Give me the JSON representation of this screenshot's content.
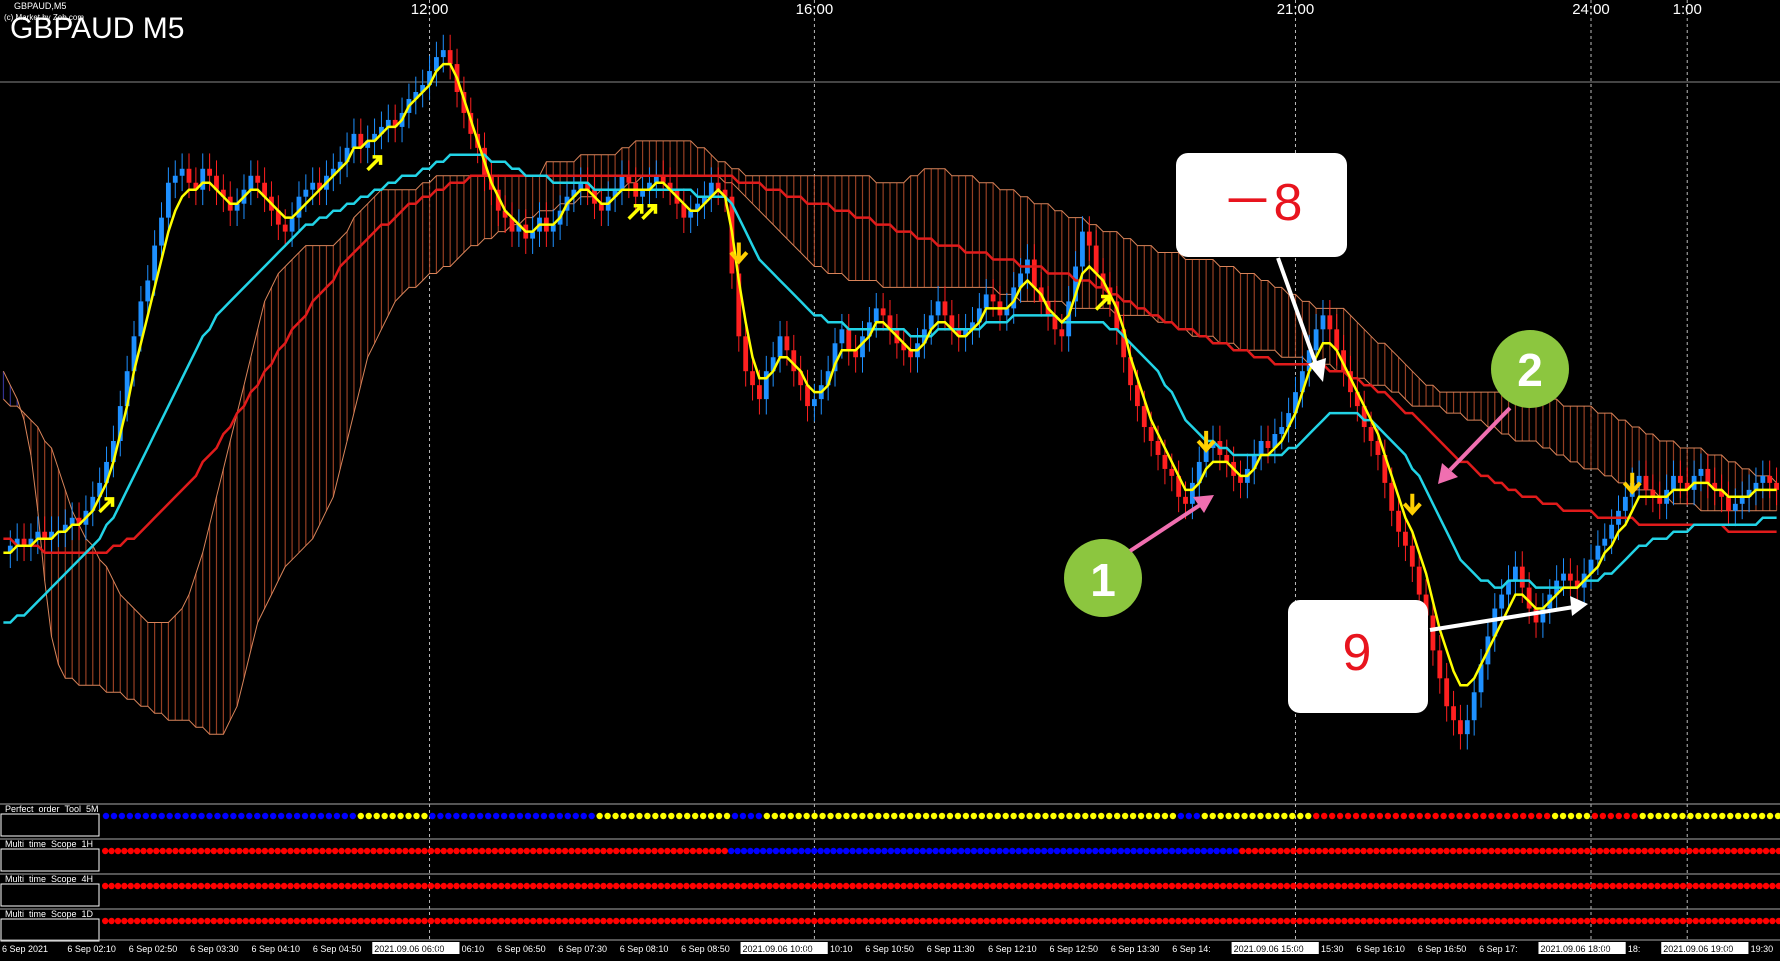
{
  "window": {
    "title": "GBPAUD,M5",
    "subtitle": "(c) Market by Zeb.com",
    "symbol_label": "GBPAUD M5"
  },
  "colors": {
    "background": "#000000",
    "bull_candle": "#1e90ff",
    "bear_candle": "#ff2020",
    "ma_fast": "#ffff00",
    "ma_mid": "#22d3e6",
    "ma_slow": "#e01b1b",
    "cloud_bear_fill": "#b04a2a",
    "cloud_bull_fill": "#3a3aa8",
    "cloud_edge": "#d8845a",
    "arrow_up": "#ffff00",
    "arrow_down": "#ffd000",
    "callout_green": "#8cc63f",
    "callout_pink": "#f06fb0",
    "callout_white": "#ffffff",
    "callout_text_red": "#e8141e",
    "dot_blue": "#0000ff",
    "dot_yellow": "#ffff00",
    "dot_red": "#ff0000"
  },
  "annotations": {
    "box_minus8": "－8",
    "box_9": "9",
    "circle_1": "1",
    "circle_2": "2"
  },
  "chart_data": {
    "type": "line",
    "price_axis": "none",
    "time_labels_top": [
      {
        "label": "12:00",
        "index": 62
      },
      {
        "label": "16:00",
        "index": 118
      },
      {
        "label": "21:00",
        "index": 188
      },
      {
        "label": "24:00",
        "index": 231
      },
      {
        "label": "1:00",
        "index": 245
      }
    ],
    "time_labels_bottom": [
      "6 Sep 2021",
      "6 Sep 02:10",
      "6 Sep 02:50",
      "6 Sep 03:30",
      "6 Sep 04:10",
      "6 Sep 04:50",
      "2021.09.06 06:00",
      "6 Sep 06:10",
      "6 Sep 06:50",
      "6 Sep 07:30",
      "6 Sep 08:10",
      "6 Sep 08:50",
      "2021.09.06 10:00",
      "6 Sep 10:10",
      "6 Sep 10:50",
      "6 Sep 11:30",
      "6 Sep 12:10",
      "6 Sep 12:50",
      "6 Sep 13:30",
      "6 Sep 14:",
      "2021.09.06 15:00",
      "6 Sep 15:30",
      "6 Sep 16:10",
      "6 Sep 16:50",
      "6 Sep 17:",
      "2021.09.06 18:00",
      "6 Sep 18:",
      "2021.09.06 19:00",
      "6 Sep 19:30"
    ],
    "bars": 259,
    "price_scale": {
      "min": 0,
      "max": 100
    },
    "close": [
      34,
      35,
      36,
      35,
      36,
      37,
      36,
      37,
      37,
      38,
      39,
      38,
      40,
      42,
      44,
      47,
      50,
      55,
      60,
      65,
      70,
      73,
      78,
      82,
      87,
      88,
      89,
      87,
      86,
      89,
      88,
      86,
      85,
      83,
      84,
      86,
      88,
      87,
      85,
      83,
      81,
      80,
      82,
      85,
      86,
      87,
      86,
      88,
      89,
      90,
      92,
      94,
      92,
      93,
      94,
      95,
      96,
      95,
      97,
      99,
      100,
      101,
      103,
      105,
      106,
      104,
      100,
      97,
      94,
      92,
      88,
      86,
      83,
      82,
      80,
      81,
      79,
      80,
      82,
      80,
      81,
      83,
      85,
      86,
      87,
      86,
      84,
      83,
      85,
      86,
      88,
      87,
      85,
      86,
      87,
      88,
      87,
      86,
      84,
      82,
      83,
      84,
      85,
      87,
      86,
      85,
      74,
      65,
      60,
      58,
      56,
      60,
      62,
      65,
      63,
      60,
      58,
      55,
      56,
      58,
      60,
      64,
      66,
      63,
      62,
      65,
      67,
      69,
      68,
      66,
      64,
      63,
      62,
      64,
      66,
      68,
      70,
      68,
      66,
      65,
      66,
      67,
      69,
      71,
      70,
      68,
      69,
      72,
      74,
      76,
      72,
      70,
      68,
      66,
      65,
      70,
      75,
      80,
      78,
      74,
      72,
      70,
      66,
      62,
      58,
      55,
      52,
      50,
      48,
      46,
      45,
      42,
      41,
      44,
      47,
      49,
      50,
      48,
      47,
      45,
      44,
      46,
      48,
      50,
      49,
      51,
      52,
      54,
      57,
      60,
      63,
      66,
      68,
      66,
      63,
      60,
      57,
      55,
      52,
      50,
      48,
      44,
      40,
      37,
      35,
      32,
      28,
      25,
      20,
      16,
      12,
      10,
      8,
      10,
      14,
      18,
      22,
      26,
      28,
      30,
      32,
      29,
      26,
      24,
      26,
      28,
      30,
      31,
      30,
      29,
      31,
      33,
      35,
      36,
      38,
      40,
      42,
      44,
      45,
      43,
      42,
      41,
      43,
      45,
      44,
      43,
      45,
      46,
      44,
      43,
      42,
      40,
      41,
      42,
      43,
      44,
      45,
      44,
      43
    ],
    "ma_fast": [
      34,
      34,
      35,
      35,
      35,
      36,
      36,
      36,
      37,
      37,
      38,
      38,
      39,
      40,
      42,
      44,
      47,
      51,
      55,
      60,
      64,
      68,
      72,
      76,
      80,
      83,
      85,
      86,
      86,
      87,
      87,
      86,
      85,
      84,
      84,
      85,
      86,
      86,
      85,
      84,
      83,
      82,
      82,
      83,
      84,
      85,
      86,
      87,
      88,
      89,
      90,
      92,
      92,
      93,
      93,
      94,
      95,
      95,
      96,
      98,
      99,
      100,
      101,
      103,
      104,
      104,
      102,
      99,
      96,
      93,
      90,
      87,
      85,
      83,
      82,
      81,
      80,
      80,
      81,
      81,
      81,
      82,
      84,
      85,
      86,
      86,
      85,
      84,
      84,
      85,
      86,
      86,
      86,
      86,
      86,
      87,
      87,
      86,
      85,
      84,
      83,
      83,
      84,
      85,
      86,
      85,
      80,
      73,
      67,
      62,
      59,
      59,
      60,
      62,
      62,
      61,
      60,
      58,
      57,
      57,
      58,
      61,
      63,
      63,
      63,
      64,
      65,
      67,
      67,
      66,
      65,
      64,
      63,
      63,
      64,
      66,
      67,
      67,
      66,
      65,
      65,
      66,
      67,
      69,
      69,
      69,
      69,
      70,
      72,
      73,
      72,
      71,
      69,
      68,
      67,
      68,
      71,
      74,
      75,
      74,
      73,
      71,
      69,
      66,
      62,
      59,
      56,
      53,
      51,
      49,
      47,
      45,
      43,
      43,
      44,
      46,
      47,
      47,
      47,
      46,
      45,
      45,
      46,
      48,
      48,
      49,
      50,
      52,
      54,
      57,
      60,
      62,
      64,
      64,
      63,
      61,
      59,
      57,
      55,
      53,
      51,
      48,
      45,
      42,
      39,
      37,
      34,
      31,
      27,
      23,
      20,
      17,
      15,
      15,
      16,
      18,
      20,
      22,
      24,
      26,
      28,
      28,
      27,
      26,
      26,
      27,
      28,
      29,
      29,
      29,
      30,
      31,
      32,
      34,
      35,
      37,
      38,
      40,
      42,
      42,
      42,
      42,
      42,
      43,
      43,
      43,
      44,
      44,
      44,
      43,
      43,
      42,
      42,
      42,
      42,
      43,
      43,
      43,
      43
    ],
    "ma_mid": [
      24,
      24,
      25,
      25,
      26,
      27,
      28,
      29,
      30,
      31,
      32,
      33,
      34,
      35,
      36,
      38,
      39,
      41,
      43,
      45,
      47,
      49,
      51,
      53,
      55,
      57,
      59,
      61,
      63,
      65,
      66,
      68,
      69,
      70,
      71,
      72,
      73,
      74,
      75,
      76,
      77,
      78,
      79,
      80,
      81,
      81,
      82,
      82,
      83,
      83,
      84,
      84,
      85,
      85,
      86,
      86,
      87,
      87,
      88,
      88,
      88,
      89,
      89,
      90,
      90,
      91,
      91,
      91,
      91,
      91,
      91,
      90,
      90,
      90,
      89,
      89,
      88,
      88,
      88,
      88,
      87,
      87,
      87,
      87,
      87,
      87,
      86,
      86,
      86,
      86,
      86,
      86,
      86,
      86,
      86,
      86,
      86,
      86,
      86,
      86,
      86,
      85,
      85,
      85,
      85,
      85,
      84,
      82,
      80,
      78,
      76,
      75,
      74,
      73,
      72,
      71,
      70,
      69,
      68,
      68,
      67,
      67,
      67,
      66,
      66,
      66,
      66,
      66,
      66,
      66,
      66,
      66,
      65,
      65,
      65,
      65,
      66,
      66,
      66,
      66,
      66,
      66,
      66,
      67,
      67,
      67,
      67,
      68,
      68,
      68,
      68,
      68,
      68,
      68,
      67,
      67,
      67,
      67,
      67,
      67,
      67,
      66,
      66,
      65,
      64,
      63,
      62,
      61,
      60,
      58,
      57,
      55,
      53,
      52,
      51,
      50,
      50,
      49,
      49,
      48,
      48,
      48,
      48,
      48,
      48,
      48,
      48,
      49,
      49,
      50,
      51,
      52,
      53,
      54,
      54,
      54,
      54,
      54,
      53,
      53,
      52,
      51,
      50,
      49,
      48,
      46,
      45,
      43,
      41,
      39,
      37,
      35,
      33,
      32,
      31,
      30,
      30,
      29,
      29,
      30,
      30,
      30,
      30,
      29,
      29,
      29,
      29,
      29,
      29,
      29,
      30,
      30,
      30,
      31,
      31,
      32,
      33,
      34,
      35,
      35,
      36,
      36,
      36,
      37,
      37,
      37,
      38,
      38,
      38,
      38,
      38,
      38,
      38,
      38,
      38,
      38,
      39,
      39,
      39
    ],
    "ma_slow": [
      36,
      36,
      35,
      35,
      35,
      35,
      34,
      34,
      34,
      34,
      34,
      34,
      34,
      34,
      34,
      34,
      35,
      35,
      36,
      36,
      37,
      38,
      39,
      40,
      41,
      42,
      43,
      44,
      45,
      47,
      48,
      49,
      51,
      52,
      54,
      55,
      57,
      58,
      60,
      61,
      63,
      64,
      66,
      67,
      68,
      70,
      71,
      72,
      73,
      75,
      76,
      77,
      78,
      79,
      80,
      81,
      81,
      82,
      83,
      84,
      84,
      85,
      85,
      86,
      86,
      87,
      87,
      87,
      88,
      88,
      88,
      88,
      88,
      88,
      88,
      88,
      88,
      88,
      88,
      88,
      88,
      88,
      88,
      88,
      88,
      88,
      88,
      88,
      88,
      88,
      88,
      88,
      88,
      88,
      88,
      88,
      88,
      88,
      88,
      88,
      88,
      88,
      88,
      88,
      88,
      88,
      88,
      87,
      87,
      87,
      87,
      86,
      86,
      86,
      85,
      85,
      85,
      84,
      84,
      84,
      84,
      83,
      83,
      83,
      82,
      82,
      82,
      81,
      81,
      81,
      80,
      80,
      80,
      79,
      79,
      79,
      78,
      78,
      78,
      78,
      77,
      77,
      77,
      77,
      76,
      76,
      76,
      76,
      75,
      75,
      75,
      75,
      74,
      74,
      74,
      74,
      73,
      73,
      73,
      72,
      72,
      71,
      71,
      70,
      70,
      69,
      69,
      68,
      68,
      67,
      67,
      66,
      66,
      66,
      65,
      65,
      64,
      64,
      64,
      63,
      63,
      63,
      62,
      62,
      62,
      61,
      61,
      61,
      61,
      61,
      61,
      61,
      61,
      60,
      60,
      60,
      59,
      59,
      58,
      58,
      57,
      57,
      56,
      55,
      54,
      54,
      53,
      52,
      51,
      50,
      49,
      48,
      47,
      47,
      46,
      45,
      45,
      44,
      44,
      43,
      43,
      42,
      42,
      42,
      41,
      41,
      41,
      40,
      40,
      40,
      40,
      40,
      39,
      39,
      39,
      39,
      39,
      39,
      38,
      38,
      38,
      38,
      38,
      38,
      38,
      38,
      38,
      38,
      38,
      38,
      38,
      37,
      37,
      37,
      37,
      37,
      37,
      37,
      37
    ],
    "cloud_top": [
      56,
      55,
      55,
      54,
      53,
      52,
      50,
      49,
      46,
      43,
      40,
      38,
      36,
      35,
      33,
      32,
      30,
      28,
      27,
      26,
      25,
      24,
      24,
      24,
      24,
      25,
      26,
      28,
      31,
      34,
      38,
      42,
      46,
      50,
      54,
      58,
      62,
      66,
      70,
      72,
      74,
      75,
      76,
      77,
      78,
      78,
      78,
      78,
      78,
      79,
      80,
      82,
      83,
      84,
      85,
      86,
      86,
      86,
      86,
      86,
      86,
      87,
      87,
      88,
      88,
      88,
      88,
      88,
      88,
      88,
      88,
      88,
      88,
      88,
      88,
      88,
      88,
      88,
      88,
      90,
      90,
      90,
      90,
      90,
      91,
      91,
      91,
      91,
      91,
      91,
      92,
      92,
      93,
      93,
      93,
      93,
      93,
      93,
      93,
      93,
      93,
      92,
      92,
      91,
      90,
      90,
      89,
      89,
      88,
      88,
      88,
      88,
      88,
      88,
      88,
      88,
      88,
      88,
      88,
      88,
      88,
      88,
      88,
      88,
      88,
      88,
      88,
      87,
      87,
      87,
      87,
      87,
      88,
      88,
      89,
      89,
      89,
      89,
      88,
      88,
      88,
      88,
      87,
      87,
      87,
      86,
      86,
      86,
      85,
      85,
      84,
      84,
      84,
      83,
      83,
      82,
      82,
      82,
      81,
      81,
      80,
      80,
      80,
      79,
      79,
      78,
      78,
      78,
      77,
      77,
      77,
      77,
      76,
      76,
      76,
      76,
      76,
      75,
      75,
      75,
      74,
      74,
      74,
      73,
      73,
      72,
      72,
      71,
      71,
      70,
      70,
      69,
      69,
      69,
      69,
      69,
      68,
      67,
      66,
      65,
      64,
      64,
      63,
      62,
      61,
      60,
      59,
      58,
      58,
      57,
      57,
      57,
      57,
      57,
      57,
      57,
      57,
      57,
      57,
      57,
      57,
      57,
      56,
      56,
      56,
      56,
      56,
      55,
      55,
      55,
      55,
      55,
      54,
      54,
      54,
      53,
      53,
      52,
      52,
      51,
      51,
      50,
      50,
      50,
      49,
      49,
      49,
      49,
      48,
      48,
      48,
      47,
      47,
      46,
      46,
      45,
      45,
      45,
      44
    ],
    "cloud_bottom": [
      60,
      58,
      56,
      53,
      48,
      40,
      30,
      22,
      18,
      16,
      16,
      15,
      15,
      15,
      15,
      14,
      14,
      14,
      13,
      13,
      12,
      12,
      11,
      11,
      10,
      10,
      10,
      10,
      9,
      9,
      8,
      8,
      8,
      10,
      12,
      16,
      20,
      24,
      26,
      28,
      30,
      32,
      33,
      34,
      35,
      36,
      38,
      40,
      42,
      46,
      50,
      54,
      58,
      62,
      64,
      66,
      68,
      70,
      71,
      72,
      72,
      73,
      74,
      74,
      75,
      75,
      76,
      77,
      78,
      78,
      79,
      79,
      80,
      80,
      81,
      81,
      82,
      82,
      83,
      83,
      83,
      84,
      84,
      84,
      85,
      85,
      85,
      86,
      86,
      86,
      86,
      87,
      87,
      88,
      88,
      88,
      88,
      88,
      88,
      88,
      88,
      88,
      88,
      88,
      88,
      87,
      87,
      86,
      85,
      84,
      83,
      82,
      81,
      80,
      79,
      78,
      77,
      76,
      75,
      75,
      74,
      74,
      74,
      73,
      73,
      73,
      73,
      73,
      72,
      72,
      72,
      72,
      72,
      72,
      72,
      72,
      72,
      72,
      72,
      72,
      72,
      72,
      72,
      72,
      72,
      71,
      71,
      71,
      70,
      70,
      70,
      70,
      70,
      70,
      70,
      69,
      69,
      69,
      69,
      69,
      69,
      69,
      68,
      68,
      68,
      68,
      68,
      68,
      67,
      67,
      67,
      66,
      66,
      65,
      65,
      65,
      65,
      64,
      64,
      64,
      63,
      63,
      63,
      63,
      63,
      63,
      62,
      62,
      62,
      62,
      61,
      61,
      61,
      61,
      60,
      60,
      59,
      59,
      59,
      58,
      58,
      58,
      57,
      57,
      56,
      55,
      55,
      55,
      55,
      55,
      54,
      54,
      54,
      53,
      53,
      53,
      52,
      52,
      51,
      51,
      50,
      50,
      50,
      50,
      49,
      49,
      48,
      48,
      47,
      47,
      46,
      46,
      46,
      45,
      45,
      44,
      44,
      43,
      43,
      43,
      43,
      42,
      42,
      41,
      41,
      41,
      41,
      40,
      40,
      40,
      40,
      40,
      40,
      40,
      40,
      40,
      40,
      40,
      40
    ],
    "arrows_up": [
      15,
      54,
      92,
      94,
      160
    ],
    "arrows_down": [
      107,
      175,
      205,
      237
    ],
    "indicator_rows": [
      {
        "name": "Perfect_order_Tool_5M",
        "segments": [
          [
            "b",
            32
          ],
          [
            "y",
            9
          ],
          [
            "b",
            21
          ],
          [
            "y",
            17
          ],
          [
            "b",
            4
          ],
          [
            "y",
            22
          ],
          [
            "y",
            30
          ],
          [
            "b",
            3
          ],
          [
            "y",
            14
          ],
          [
            "r",
            30
          ],
          [
            "y",
            5
          ],
          [
            "r",
            6
          ],
          [
            "y",
            18
          ]
        ]
      },
      {
        "name": "Multi_time_Scope_1H",
        "segments": [
          [
            "r",
            98
          ],
          [
            "b",
            80
          ],
          [
            "r",
            85
          ]
        ]
      },
      {
        "name": "Multi_time_Scope_4H",
        "segments": [
          [
            "r",
            263
          ]
        ]
      },
      {
        "name": "Multi_time_Scope_1D",
        "segments": [
          [
            "r",
            263
          ]
        ]
      }
    ]
  }
}
